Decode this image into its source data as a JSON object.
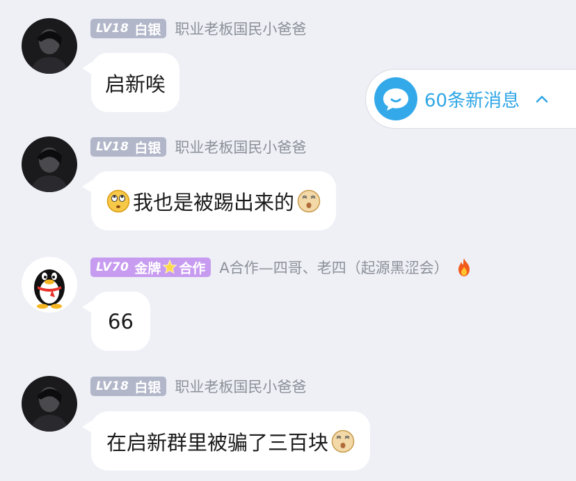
{
  "messages": [
    {
      "level": "LV18",
      "title": "白银",
      "nick": "职业老板国民小爸爸",
      "text": "启新唉"
    },
    {
      "level": "LV18",
      "title": "白银",
      "nick": "职业老板国民小爸爸",
      "text": "我也是被踢出来的"
    },
    {
      "level": "LV70",
      "title_a": "金牌",
      "title_b": "合作",
      "nick": "A合作—四哥、老四（起源黑涩会）",
      "text": "66"
    },
    {
      "level": "LV18",
      "title": "白银",
      "nick": "职业老板国民小爸爸",
      "text": "在启新群里被骗了三百块"
    }
  ],
  "new_messages": {
    "label": "60条新消息"
  },
  "colors": {
    "background": "#eef0f6",
    "silver_badge": "#b1b6c9",
    "gold_badge": "#c79cf0",
    "accent_blue": "#2fa6e6"
  },
  "icons": [
    "dark-avatar-icon",
    "qq-penguin-icon",
    "chat-bubble-icon",
    "chevron-up-icon",
    "fire-icon",
    "rolling-eyes-emoji",
    "dizzy-face-emoji",
    "star-icon"
  ]
}
